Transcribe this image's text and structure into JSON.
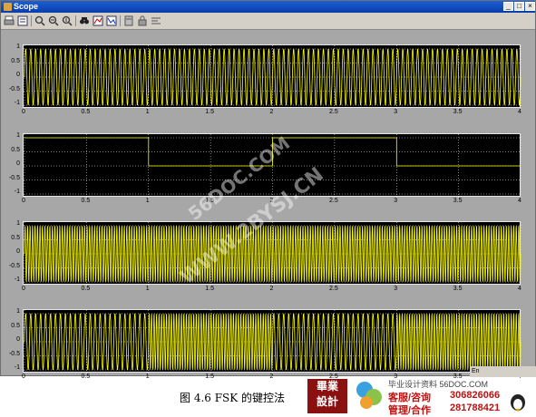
{
  "window": {
    "title": "Scope",
    "min_btn": "_",
    "max_btn": "□",
    "close_btn": "×"
  },
  "toolbar": {
    "icons": [
      "print-icon",
      "parameters-icon",
      "zoom-icon",
      "zoom-x-icon",
      "zoom-y-icon",
      "autoscale-icon",
      "save-axes-icon",
      "restore-axes-icon",
      "floating-scope-icon",
      "lock-axes-icon",
      "signal-selector-icon"
    ]
  },
  "chart_data": [
    {
      "type": "line",
      "title": "",
      "xlabel": "",
      "ylabel": "",
      "xlim": [
        0,
        4
      ],
      "ylim": [
        -1,
        1
      ],
      "xticks": [
        "0",
        "0.5",
        "1",
        "1.5",
        "2",
        "2.5",
        "3",
        "3.5",
        "4"
      ],
      "yticks": [
        "1",
        "0.5",
        "0",
        "-0.5",
        "-1"
      ],
      "series": [
        {
          "kind": "sine",
          "amplitude": 1,
          "cycles_per_unit": 25
        }
      ],
      "grid": true
    },
    {
      "type": "line",
      "title": "",
      "xlabel": "",
      "ylabel": "",
      "xlim": [
        0,
        4
      ],
      "ylim": [
        -1,
        1
      ],
      "xticks": [
        "0",
        "0.5",
        "1",
        "1.5",
        "2",
        "2.5",
        "3",
        "3.5",
        "4"
      ],
      "yticks": [
        "1",
        "0.5",
        "0",
        "-0.5",
        "-1"
      ],
      "series": [
        {
          "kind": "step",
          "x": [
            0,
            1,
            1,
            2,
            2,
            3,
            3,
            4
          ],
          "y": [
            1,
            1,
            0,
            0,
            1,
            1,
            0,
            0
          ]
        }
      ],
      "grid": true
    },
    {
      "type": "line",
      "title": "",
      "xlabel": "",
      "ylabel": "",
      "xlim": [
        0,
        4
      ],
      "ylim": [
        -1,
        1
      ],
      "xticks": [
        "0",
        "0.5",
        "1",
        "1.5",
        "2",
        "2.5",
        "3",
        "3.5",
        "4"
      ],
      "yticks": [
        "1",
        "0.5",
        "0",
        "-0.5",
        "-1"
      ],
      "series": [
        {
          "kind": "sine",
          "amplitude": 1,
          "cycles_per_unit": 50
        }
      ],
      "grid": true
    },
    {
      "type": "line",
      "title": "",
      "xlabel": "",
      "ylabel": "",
      "xlim": [
        0,
        4
      ],
      "ylim": [
        -1,
        1
      ],
      "xticks": [
        "0",
        "0.5",
        "1",
        "1.5",
        "2",
        "2.5",
        "3",
        "3.5",
        "4"
      ],
      "yticks": [
        "1",
        "0.5",
        "0",
        "-0.5",
        "-1"
      ],
      "series": [
        {
          "kind": "fsk",
          "amplitude": 1,
          "segments": [
            [
              0,
              1,
              25
            ],
            [
              1,
              2,
              50
            ],
            [
              2,
              3,
              25
            ],
            [
              3,
              4,
              50
            ]
          ]
        }
      ],
      "grid": true
    }
  ],
  "watermark": {
    "line1": "56DOC.COM",
    "line2": "WWW.2BYSJ.CN"
  },
  "caption": "图 4.6  FSK 的键控法",
  "taskbar": {
    "lang": "En"
  },
  "logo": {
    "line1": "畢業",
    "line2": "設計"
  },
  "site": {
    "title": "毕业设计资料 56DOC.COM",
    "row1_label": "客服/咨询",
    "row1_qq": "306826066",
    "row2_label": "管理/合作",
    "row2_qq": "281788421"
  },
  "colors": {
    "trace": "#ffff00",
    "axes_bg": "#000000",
    "figure_bg": "#a7a7a7",
    "grid": "#ffffff"
  }
}
